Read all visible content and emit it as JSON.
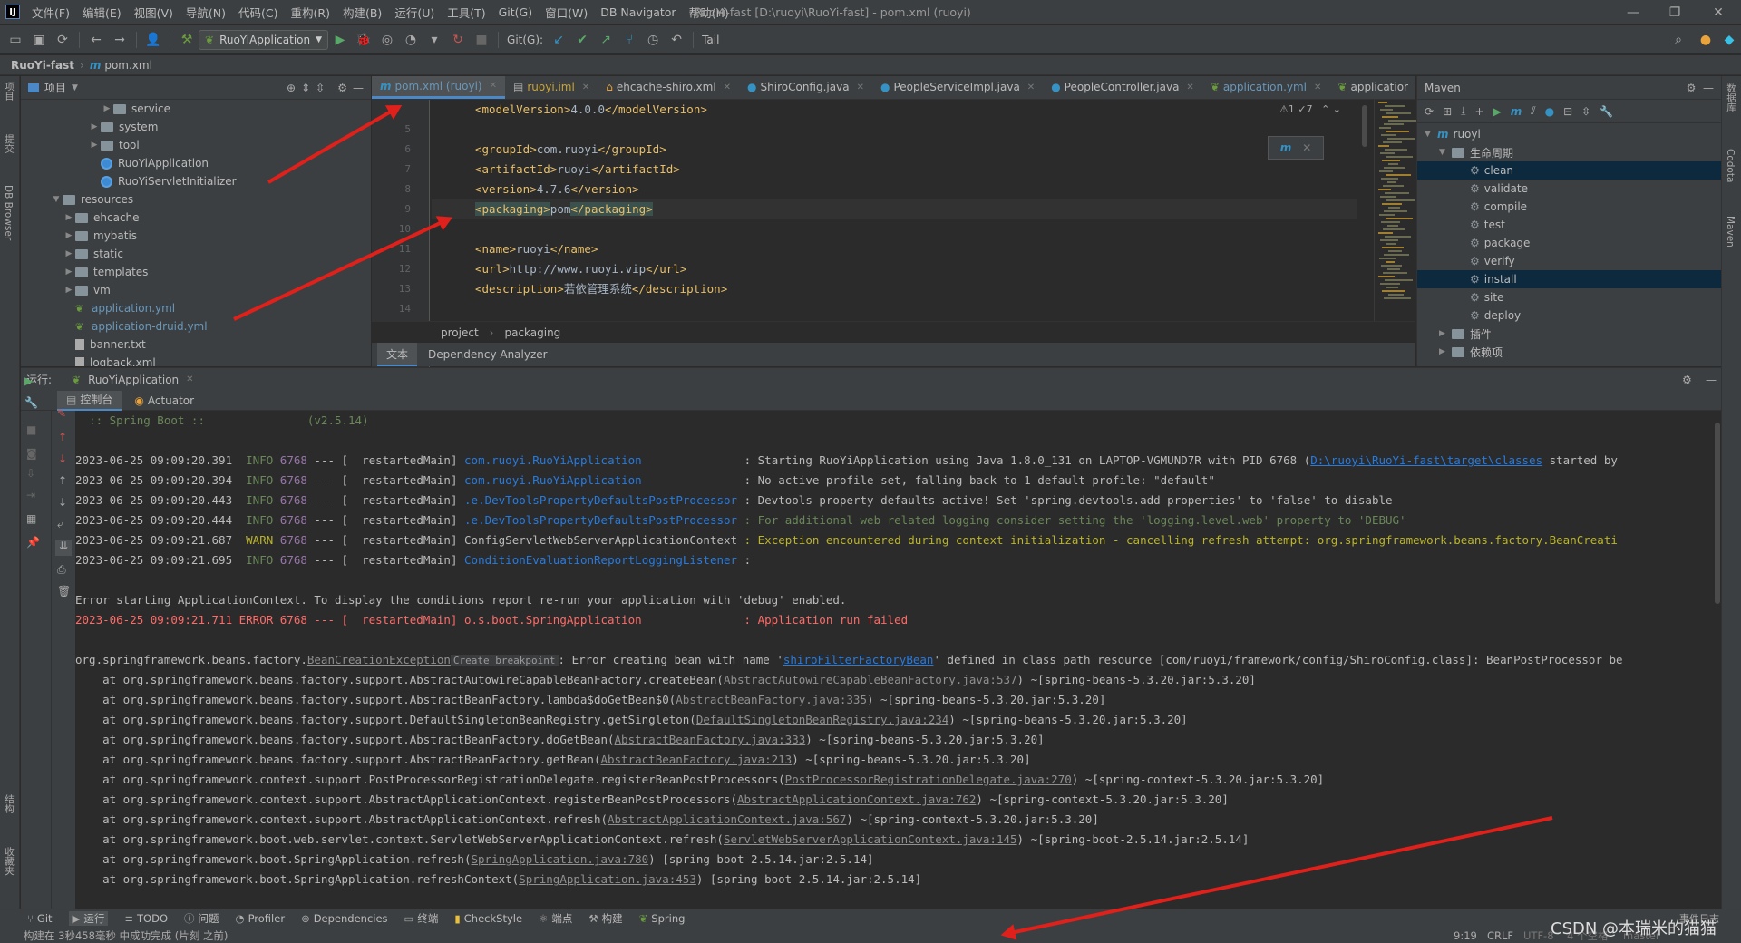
{
  "menu": {
    "items": [
      "文件(F)",
      "编辑(E)",
      "视图(V)",
      "导航(N)",
      "代码(C)",
      "重构(R)",
      "构建(B)",
      "运行(U)",
      "工具(T)",
      "Git(G)",
      "窗口(W)",
      "DB Navigator",
      "帮助(H)"
    ],
    "window_title": "RuoYi-fast [D:\\ruoyi\\RuoYi-fast] - pom.xml (ruoyi)"
  },
  "toolbar": {
    "run_config": "RuoYiApplication",
    "git_label": "Git(G):",
    "tail_label": "Tail"
  },
  "navbar": {
    "project": "RuoYi-fast",
    "file": "pom.xml"
  },
  "left_stripe": [
    "项目",
    "提交",
    "DB Browser",
    "结构",
    "收藏夹"
  ],
  "right_stripe": [
    "数据库",
    "Codota",
    "Maven"
  ],
  "project_panel": {
    "title": "项目",
    "tree": [
      {
        "label": "service",
        "type": "folder",
        "indent": 6,
        "expanded": false
      },
      {
        "label": "system",
        "type": "folder",
        "indent": 5,
        "expanded": false
      },
      {
        "label": "tool",
        "type": "folder",
        "indent": 5,
        "expanded": false
      },
      {
        "label": "RuoYiApplication",
        "type": "class",
        "indent": 5
      },
      {
        "label": "RuoYiServletInitializer",
        "type": "class",
        "indent": 5
      },
      {
        "label": "resources",
        "type": "folder",
        "indent": 2,
        "expanded": true
      },
      {
        "label": "ehcache",
        "type": "folder",
        "indent": 3,
        "expanded": false
      },
      {
        "label": "mybatis",
        "type": "folder",
        "indent": 3,
        "expanded": false
      },
      {
        "label": "static",
        "type": "folder",
        "indent": 3,
        "expanded": false
      },
      {
        "label": "templates",
        "type": "folder",
        "indent": 3,
        "expanded": false
      },
      {
        "label": "vm",
        "type": "folder",
        "indent": 3,
        "expanded": false
      },
      {
        "label": "application.yml",
        "type": "yml",
        "indent": 3
      },
      {
        "label": "application-druid.yml",
        "type": "yml",
        "indent": 3
      },
      {
        "label": "banner.txt",
        "type": "file",
        "indent": 3
      },
      {
        "label": "logback.xml",
        "type": "file",
        "indent": 3
      }
    ]
  },
  "editor": {
    "tabs": [
      {
        "label": "pom.xml (ruoyi)",
        "active": true
      },
      {
        "label": "ruoyi.iml",
        "active": false
      },
      {
        "label": "ehcache-shiro.xml",
        "active": false
      },
      {
        "label": "ShiroConfig.java",
        "active": false
      },
      {
        "label": "PeopleServiceImpl.java",
        "active": false
      },
      {
        "label": "PeopleController.java",
        "active": false
      },
      {
        "label": "application.yml",
        "active": false
      },
      {
        "label": "applicatior",
        "active": false
      }
    ],
    "line_numbers": [
      "",
      "5",
      "6",
      "7",
      "8",
      "9",
      "10",
      "11",
      "12",
      "13",
      "14"
    ],
    "lines": [
      {
        "open": "<modelVersion>",
        "text": "4.0.0",
        "close": "</modelVersion>"
      },
      {
        "open": "",
        "text": "",
        "close": ""
      },
      {
        "open": "<groupId>",
        "text": "com.ruoyi",
        "close": "</groupId>"
      },
      {
        "open": "<artifactId>",
        "text": "ruoyi",
        "close": "</artifactId>"
      },
      {
        "open": "<version>",
        "text": "4.7.6",
        "close": "</version>"
      },
      {
        "open": "<packaging>",
        "text": "pom",
        "close": "</packaging>",
        "highlight": true
      },
      {
        "open": "",
        "text": "",
        "close": ""
      },
      {
        "open": "<name>",
        "text": "ruoyi",
        "close": "</name>"
      },
      {
        "open": "<url>",
        "text": "http://www.ruoyi.vip",
        "close": "</url>"
      },
      {
        "open": "<description>",
        "text": "若依管理系统",
        "close": "</description>"
      },
      {
        "open": "",
        "text": "",
        "close": ""
      }
    ],
    "inspection": "⚠1 ✓7",
    "breadcrumb": [
      "project",
      "packaging"
    ],
    "bottom_tabs": [
      {
        "label": "文本",
        "active": true
      },
      {
        "label": "Dependency Analyzer",
        "active": false
      }
    ]
  },
  "maven": {
    "title": "Maven",
    "project": "ruoyi",
    "lifecycle": "生命周期",
    "goals": [
      {
        "label": "clean",
        "selected": true
      },
      {
        "label": "validate",
        "selected": false
      },
      {
        "label": "compile",
        "selected": false
      },
      {
        "label": "test",
        "selected": false
      },
      {
        "label": "package",
        "selected": false
      },
      {
        "label": "verify",
        "selected": false
      },
      {
        "label": "install",
        "selected": true
      },
      {
        "label": "site",
        "selected": false
      },
      {
        "label": "deploy",
        "selected": false
      }
    ],
    "plugins": "插件",
    "dependencies": "依赖项"
  },
  "run": {
    "label": "运行:",
    "config": "RuoYiApplication",
    "tabs": [
      "控制台",
      "Actuator"
    ],
    "banner": "  :: Spring Boot ::               (v2.5.14)",
    "log": [
      {
        "dt": "2023-06-25 09:09:20.391",
        "lvl": "INFO",
        "pid": "6768",
        "thread": "restartedMain",
        "logger": "com.ruoyi.RuoYiApplication              ",
        "msg": ": Starting RuoYiApplication using Java 1.8.0_131 on LAPTOP-VGMUND7R with PID 6768 (",
        "link": "D:\\ruoyi\\RuoYi-fast\\target\\classes",
        "tail": " started by"
      },
      {
        "dt": "2023-06-25 09:09:20.394",
        "lvl": "INFO",
        "pid": "6768",
        "thread": "restartedMain",
        "logger": "com.ruoyi.RuoYiApplication              ",
        "msg": ": No active profile set, falling back to 1 default profile: \"default\"",
        "link": "",
        "tail": ""
      },
      {
        "dt": "2023-06-25 09:09:20.443",
        "lvl": "INFO",
        "pid": "6768",
        "thread": "restartedMain",
        "logger": ".e.DevToolsPropertyDefaultsPostProcessor",
        "msg": ": Devtools property defaults active! Set 'spring.devtools.add-properties' to 'false' to disable",
        "link": "",
        "tail": ""
      },
      {
        "dt": "2023-06-25 09:09:20.444",
        "lvl": "INFO",
        "pid": "6768",
        "thread": "restartedMain",
        "logger": ".e.DevToolsPropertyDefaultsPostProcessor",
        "msg": ": For additional web related logging consider setting the 'logging.level.web' property to 'DEBUG'",
        "link": "",
        "tail": "",
        "green": true
      },
      {
        "dt": "2023-06-25 09:09:21.687",
        "lvl": "WARN",
        "pid": "6768",
        "thread": "restartedMain",
        "logger": "ConfigServletWebServerApplicationContext",
        "msg": ": Exception encountered during context initialization - cancelling refresh attempt: org.springframework.beans.factory.BeanCreati",
        "link": "",
        "tail": ""
      },
      {
        "dt": "2023-06-25 09:09:21.695",
        "lvl": "INFO",
        "pid": "6768",
        "thread": "restartedMain",
        "logger": "ConditionEvaluationReportLoggingListener",
        "msg": ":",
        "link": "",
        "tail": ""
      }
    ],
    "error_start": "Error starting ApplicationContext. To display the conditions report re-run your application with 'debug' enabled.",
    "error_line": "2023-06-25 09:09:21.711 ERROR 6768 --- [  restartedMain] o.s.boot.SpringApplication               : Application run failed",
    "exception": {
      "prefix": "org.springframework.beans.factory.",
      "cls": "BeanCreationException",
      "bp": "Create breakpoint",
      "mid": ": Error creating bean with name '",
      "bean": "shiroFilterFactoryBean",
      "rest": "' defined in class path resource [com/ruoyi/framework/config/ShiroConfig.class]: BeanPostProcessor be"
    },
    "stack": [
      {
        "pre": "    at org.springframework.beans.factory.support.AbstractAutowireCapableBeanFactory.createBean(",
        "link": "AbstractAutowireCapableBeanFactory.java:537",
        "post": ") ~[spring-beans-5.3.20.jar:5.3.20]"
      },
      {
        "pre": "    at org.springframework.beans.factory.support.AbstractBeanFactory.lambda$doGetBean$0(",
        "link": "AbstractBeanFactory.java:335",
        "post": ") ~[spring-beans-5.3.20.jar:5.3.20]"
      },
      {
        "pre": "    at org.springframework.beans.factory.support.DefaultSingletonBeanRegistry.getSingleton(",
        "link": "DefaultSingletonBeanRegistry.java:234",
        "post": ") ~[spring-beans-5.3.20.jar:5.3.20]"
      },
      {
        "pre": "    at org.springframework.beans.factory.support.AbstractBeanFactory.doGetBean(",
        "link": "AbstractBeanFactory.java:333",
        "post": ") ~[spring-beans-5.3.20.jar:5.3.20]"
      },
      {
        "pre": "    at org.springframework.beans.factory.support.AbstractBeanFactory.getBean(",
        "link": "AbstractBeanFactory.java:213",
        "post": ") ~[spring-beans-5.3.20.jar:5.3.20]"
      },
      {
        "pre": "    at org.springframework.context.support.PostProcessorRegistrationDelegate.registerBeanPostProcessors(",
        "link": "PostProcessorRegistrationDelegate.java:270",
        "post": ") ~[spring-context-5.3.20.jar:5.3.20]"
      },
      {
        "pre": "    at org.springframework.context.support.AbstractApplicationContext.registerBeanPostProcessors(",
        "link": "AbstractApplicationContext.java:762",
        "post": ") ~[spring-context-5.3.20.jar:5.3.20]"
      },
      {
        "pre": "    at org.springframework.context.support.AbstractApplicationContext.refresh(",
        "link": "AbstractApplicationContext.java:567",
        "post": ") ~[spring-context-5.3.20.jar:5.3.20]"
      },
      {
        "pre": "    at org.springframework.boot.web.servlet.context.ServletWebServerApplicationContext.refresh(",
        "link": "ServletWebServerApplicationContext.java:145",
        "post": ") ~[spring-boot-2.5.14.jar:2.5.14]"
      },
      {
        "pre": "    at org.springframework.boot.SpringApplication.refresh(",
        "link": "SpringApplication.java:780",
        "post": ") [spring-boot-2.5.14.jar:2.5.14]"
      },
      {
        "pre": "    at org.springframework.boot.SpringApplication.refreshContext(",
        "link": "SpringApplication.java:453",
        "post": ") [spring-boot-2.5.14.jar:2.5.14]"
      }
    ]
  },
  "bottom_tabs": [
    "Git",
    "运行",
    "TODO",
    "问题",
    "Profiler",
    "Dependencies",
    "终端",
    "CheckStyle",
    "端点",
    "构建",
    "Spring"
  ],
  "status": {
    "message": "构建在 3秒458毫秒 中成功完成 (片刻 之前)",
    "position": "9:19",
    "line_sep": "CRLF",
    "encoding": "UTF-8",
    "indent": "4 个空格",
    "branch": "master",
    "event_log": "事件日志",
    "watermark": "CSDN @本瑞米的猫猫"
  },
  "colors": {
    "accent": "#4a88c7",
    "error": "#ff6b68",
    "annotation": "#e0201a"
  }
}
